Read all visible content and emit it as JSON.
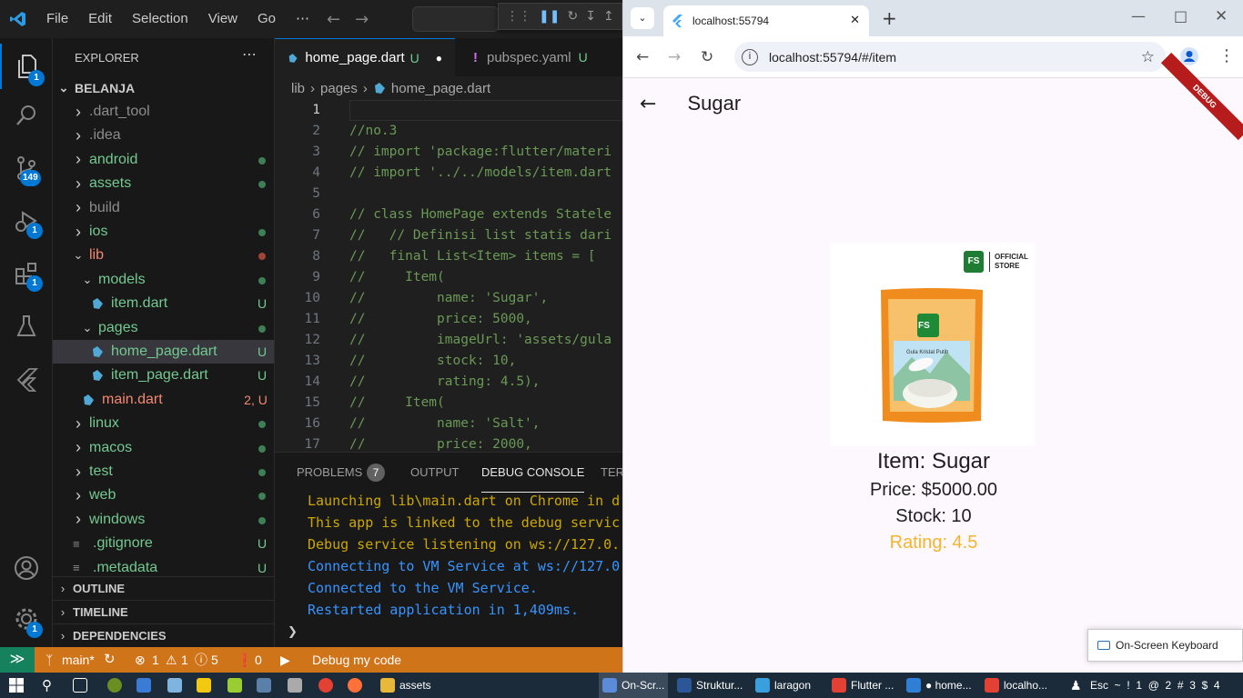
{
  "vscode": {
    "menu": [
      "File",
      "Edit",
      "Selection",
      "View",
      "Go",
      "⋯"
    ],
    "activity_badges": {
      "explorer": "1",
      "scm": "149",
      "debug": "1",
      "extensions": "1",
      "manage": "1"
    },
    "explorer": {
      "title": "EXPLORER",
      "more": "⋯",
      "root": "BELANJA",
      "items": [
        {
          "name": ".dart_tool",
          "type": "folder",
          "status": "",
          "color": "gray"
        },
        {
          "name": ".idea",
          "type": "folder",
          "status": "",
          "color": "gray"
        },
        {
          "name": "android",
          "type": "folder",
          "status": "dot",
          "color": "green"
        },
        {
          "name": "assets",
          "type": "folder",
          "status": "dot",
          "color": "green"
        },
        {
          "name": "build",
          "type": "folder",
          "status": "",
          "color": "gray"
        },
        {
          "name": "ios",
          "type": "folder",
          "status": "dot",
          "color": "green"
        },
        {
          "name": "lib",
          "type": "folder",
          "status": "dotr",
          "color": "red",
          "open": true
        },
        {
          "name": "models",
          "type": "folder",
          "status": "dot",
          "color": "green",
          "open": true,
          "indent": 1
        },
        {
          "name": "item.dart",
          "type": "dart",
          "status": "U",
          "color": "green",
          "indent": 2
        },
        {
          "name": "pages",
          "type": "folder",
          "status": "dot",
          "color": "green",
          "open": true,
          "indent": 1
        },
        {
          "name": "home_page.dart",
          "type": "dart",
          "status": "U",
          "color": "green",
          "indent": 2,
          "selected": true
        },
        {
          "name": "item_page.dart",
          "type": "dart",
          "status": "U",
          "color": "green",
          "indent": 2
        },
        {
          "name": "main.dart",
          "type": "dart",
          "status": "2, U",
          "color": "red",
          "indent": 1
        },
        {
          "name": "linux",
          "type": "folder",
          "status": "dot",
          "color": "green"
        },
        {
          "name": "macos",
          "type": "folder",
          "status": "dot",
          "color": "green"
        },
        {
          "name": "test",
          "type": "folder",
          "status": "dot",
          "color": "green"
        },
        {
          "name": "web",
          "type": "folder",
          "status": "dot",
          "color": "green"
        },
        {
          "name": "windows",
          "type": "folder",
          "status": "dot",
          "color": "green"
        },
        {
          "name": ".gitignore",
          "type": "file",
          "status": "U",
          "color": "green"
        },
        {
          "name": ".metadata",
          "type": "file",
          "status": "U",
          "color": "green"
        }
      ],
      "sections": [
        "OUTLINE",
        "TIMELINE",
        "DEPENDENCIES"
      ]
    },
    "tabs": [
      {
        "label": "home_page.dart",
        "status": "U",
        "dirty": "●"
      },
      {
        "label": "pubspec.yaml",
        "status": "U",
        "prefix": "!"
      }
    ],
    "breadcrumb": [
      "lib",
      "pages",
      "home_page.dart"
    ],
    "code": [
      {
        "n": "1",
        "t": ""
      },
      {
        "n": "2",
        "t": "//no.3"
      },
      {
        "n": "3",
        "t": "// import 'package:flutter/materi"
      },
      {
        "n": "4",
        "t": "// import '../../models/item.dart"
      },
      {
        "n": "5",
        "t": ""
      },
      {
        "n": "6",
        "t": "// class HomePage extends Statele"
      },
      {
        "n": "7",
        "t": "//   // Definisi list statis dari"
      },
      {
        "n": "8",
        "t": "//   final List<Item> items = ["
      },
      {
        "n": "9",
        "t": "//     Item("
      },
      {
        "n": "10",
        "t": "//         name: 'Sugar',"
      },
      {
        "n": "11",
        "t": "//         price: 5000,"
      },
      {
        "n": "12",
        "t": "//         imageUrl: 'assets/gula"
      },
      {
        "n": "13",
        "t": "//         stock: 10,"
      },
      {
        "n": "14",
        "t": "//         rating: 4.5),"
      },
      {
        "n": "15",
        "t": "//     Item("
      },
      {
        "n": "16",
        "t": "//         name: 'Salt',"
      },
      {
        "n": "17",
        "t": "//         price: 2000,"
      }
    ],
    "panel": {
      "tabs": [
        "PROBLEMS",
        "OUTPUT",
        "DEBUG CONSOLE",
        "TERI"
      ],
      "problems_count": "7",
      "console": [
        {
          "t": "Launching lib\\main.dart on Chrome in d",
          "c": "#cca700"
        },
        {
          "t": "This app is linked to the debug servic",
          "c": "#cca700"
        },
        {
          "t": "Debug service listening on ws://127.0.",
          "c": "#cca700"
        },
        {
          "t": "Connecting to VM Service at ws://127.0",
          "c": "#3794ff"
        },
        {
          "t": "Connected to the VM Service.",
          "c": "#3794ff"
        },
        {
          "t": "Restarted application in 1,409ms.",
          "c": "#3794ff"
        }
      ],
      "prompt": "❯"
    },
    "status": {
      "branch": "main*",
      "errors": "1",
      "warnings": "1",
      "info": "5",
      "ports": "0",
      "debug": "Debug my code"
    }
  },
  "chrome": {
    "tab_title": "localhost:55794",
    "url": "localhost:55794/#/item",
    "app": {
      "title": "Sugar",
      "debug_banner": "DEBUG",
      "item_name": "Item: Sugar",
      "price": "Price: $5000.00",
      "stock": "Stock: 10",
      "rating": "Rating: 4.5",
      "rating_color": "#f5b52b",
      "official": "OFFICIAL",
      "store": "STORE",
      "logo": "FS",
      "product_label": "Gula Kristal Putih"
    }
  },
  "osk": "On-Screen Keyboard",
  "taskbar": {
    "items": [
      {
        "label": "assets",
        "color": "#e8b83a"
      },
      {
        "label": "On-Scr...",
        "color": "#5b8bd9"
      },
      {
        "label": "Struktur...",
        "color": "#2b5797"
      },
      {
        "label": "laragon",
        "color": "#3aa0dd"
      },
      {
        "label": "Flutter ...",
        "color": "#e34133"
      },
      {
        "label": "● home...",
        "color": "#2f7fd6"
      },
      {
        "label": "localho...",
        "color": "#e34133"
      }
    ],
    "tray": "Esc  ~  !  1  @  2  #  3  $  4"
  }
}
